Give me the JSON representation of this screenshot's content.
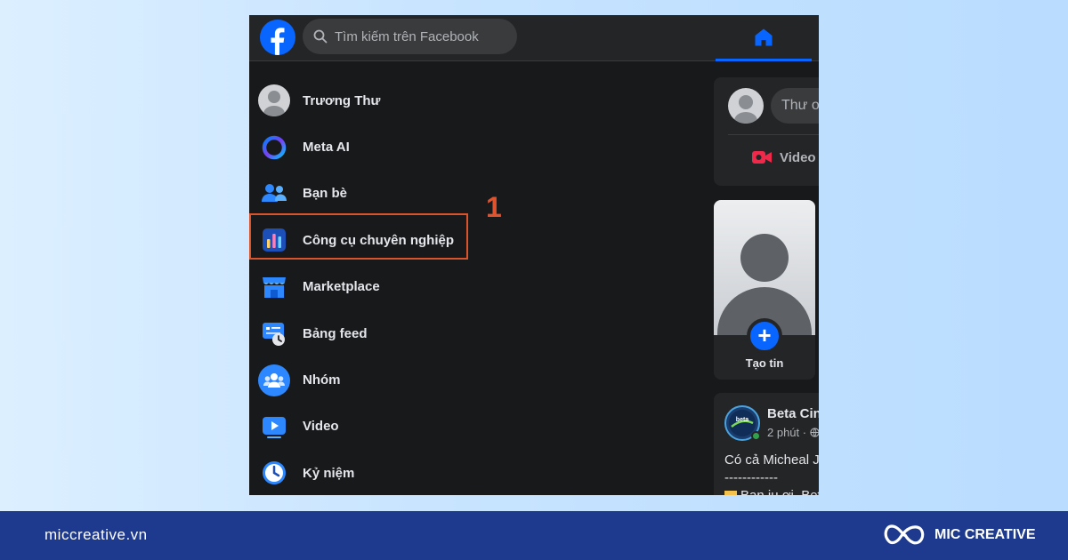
{
  "search": {
    "placeholder": "Tìm kiếm trên Facebook"
  },
  "nav": {
    "items": [
      {
        "label": "Trương Thư",
        "icon": "profile-avatar"
      },
      {
        "label": "Meta AI",
        "icon": "meta-ai-icon"
      },
      {
        "label": "Bạn bè",
        "icon": "friends-icon"
      },
      {
        "label": "Công cụ chuyên nghiệp",
        "icon": "professional-tools-icon"
      },
      {
        "label": "Marketplace",
        "icon": "marketplace-icon"
      },
      {
        "label": "Bảng feed",
        "icon": "feed-icon"
      },
      {
        "label": "Nhóm",
        "icon": "groups-icon"
      },
      {
        "label": "Video",
        "icon": "video-icon"
      },
      {
        "label": "Kỷ niệm",
        "icon": "memories-icon"
      }
    ]
  },
  "annotation": {
    "step": "1",
    "color": "#d9532c"
  },
  "composer": {
    "placeholder": "Thư ơ",
    "video_label": "Video"
  },
  "story": {
    "label": "Tạo tin"
  },
  "post": {
    "name": "Beta Cine",
    "time": "2 phút ·",
    "line1": "Có cả Micheal Ja",
    "line2": "------------",
    "line3": "Bạn iu ơi, Bet"
  },
  "footer": {
    "site": "miccreative.vn",
    "brand": "MIC CREATIVE"
  },
  "colors": {
    "accent": "#0866ff",
    "background": "#18191a",
    "footer": "#1d3a8f"
  }
}
